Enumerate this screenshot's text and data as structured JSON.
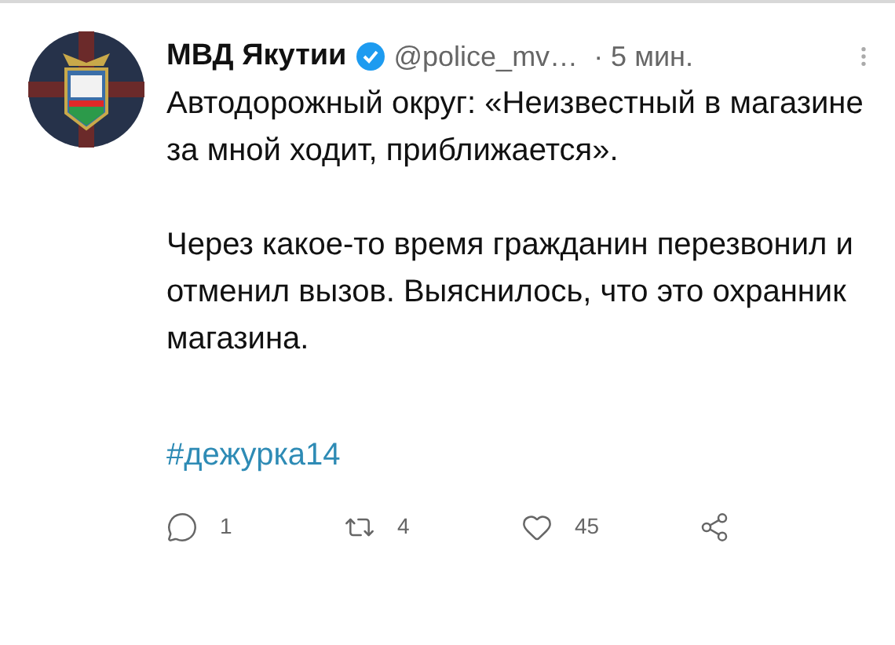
{
  "tweet": {
    "name": "МВД Якутии",
    "verified": true,
    "handle": "@police_mv…",
    "time": "· 5 мин.",
    "paragraphs": [
      "Автодорожный округ: «Неизвестный в магазине за мной ходит, приближается».",
      "Через какое-то время гражданин перезвонил и отменил вызов. Выяснилось, что это охранник магазина."
    ],
    "hashtag": "#дежурка14",
    "actions": [
      {
        "kind": "reply",
        "count": "1"
      },
      {
        "kind": "retweet",
        "count": "4"
      },
      {
        "kind": "like",
        "count": "45"
      },
      {
        "kind": "share"
      }
    ]
  }
}
